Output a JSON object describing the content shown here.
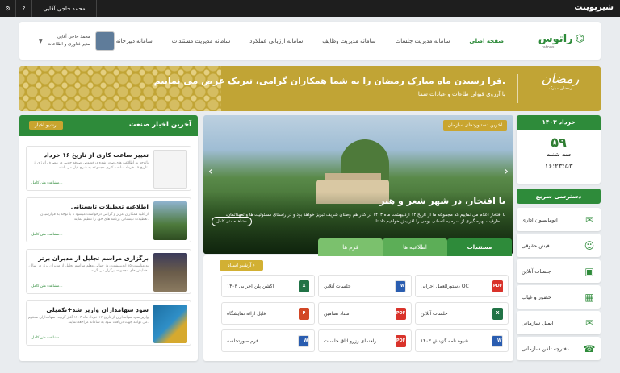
{
  "topbar": {
    "brand": "شیرپوینت",
    "user": "محمد حاجی آقایی",
    "help": "?"
  },
  "nav": {
    "logo": "راتوس",
    "logo_sub": "ratoos",
    "menu": [
      "صفحه اصلی",
      "سامانه مدیریت جلسات",
      "سامانه مدیریت وظایف",
      "سامانه ارزیابی عملکرد",
      "سامانه مدیریت مستندات",
      "سامانه دبیرخانه"
    ],
    "user_name": "محمد حاجی آقایی",
    "user_role": "مدیر فناوری و اطلاعات"
  },
  "banner": {
    "logo_text": "رمضان",
    "logo_sub": "رمضان مبارک",
    "title": "فرا رسیدن ماه مبارک رمضان را به شما همکاران گرامی، تبریک عرض می نماییم.",
    "subtitle": "با آرزوی قبولی طاعات و عبادات شما"
  },
  "date": {
    "month": "خرداد ۱۴۰۳",
    "day": "۵۹",
    "weekday": "سه شنبه",
    "time": "۱۶:۲۳:۵۳"
  },
  "quick": {
    "title": "دسترسی سریع",
    "items": [
      {
        "label": "اتوماسیون اداری",
        "icon": "mail-icon"
      },
      {
        "label": "فیش حقوقی",
        "icon": "salary-icon"
      },
      {
        "label": "جلسات آنلاین",
        "icon": "meeting-icon"
      },
      {
        "label": "حضور و غیاب",
        "icon": "calendar-icon"
      },
      {
        "label": "ایمیل سازمانی",
        "icon": "email-icon"
      },
      {
        "label": "دفترچه تلفن سازمانی",
        "icon": "phone-icon"
      }
    ]
  },
  "slider": {
    "tag": "آخرین دستاوردهای سازمان",
    "title": "با افتخار، در شهر شعر و هنر",
    "desc": "با افتخار اعلام می نماییم که مجموعه ما از تاریخ ۱۲ اردیبهشت ماه ۱۴۰۳ در کنار هم وطنان شریف تبریز خواهد بود و در راستای مسئولیت ها و تعهداتمان، ظرفیت بهره گیری از سرمایه انسانی بومی را افزایش خواهیم داد تا ...",
    "more": "مشاهده متن کامل"
  },
  "docs": {
    "tabs": [
      "مستندات",
      "اطلاعیه ها",
      "فرم ها"
    ],
    "archive": "آرشیو اسناد",
    "items": [
      {
        "label": "دستورالعمل اجرایی QC",
        "type": "PDF"
      },
      {
        "label": "جلسات آنلاین",
        "type": "W"
      },
      {
        "label": "اکشن پلن اجرایی ۱۴۰۳",
        "type": "X"
      },
      {
        "label": "جلسات آنلاین",
        "type": "X"
      },
      {
        "label": "اسناد تضامین",
        "type": "PDF"
      },
      {
        "label": "فایل ارائه نمایشگاه",
        "type": "P"
      },
      {
        "label": "شیوه نامه گزینش ۱۴۰۳",
        "type": "W"
      },
      {
        "label": "راهنمای رزرو اتاق جلسات",
        "type": "PDF"
      },
      {
        "label": "فرم صورتجلسه",
        "type": "W"
      }
    ]
  },
  "news": {
    "title": "آخرین اخبار صنعت",
    "archive": "آرشیو اخبار",
    "more": "مشاهده متن کامل...",
    "items": [
      {
        "title": "تغییر ساعت کاری از تاریخ ۱۶ خرداد",
        "desc": "باتوجه به اطلاعیه های صادر شده درخصوص صرفه جویی در مصرف انرژی از تاریخ ۱۶ خرداد ساعت کاری مجموعه به شرح ذیل می باشد."
      },
      {
        "title": "اطلاعیه تعطیلات تابستانی",
        "desc": "از کلیه همکاران عزیز و گرامی درخواست میشود تا با توجه به فرارسیدن تعطیلات تابستانی برنامه های خود را تنظیم نمایند."
      },
      {
        "title": "برگزاری مراسم تجلیل از مدیران برتر",
        "desc": "به مناسبت ۱۵ اردیبهشت روز جهانی معلم مراسم تجلیل از مدیران برتر در سالن همایش های مجموعه برگزار می گردد."
      },
      {
        "title": "سود سهامداران واریز شد+تکمیلی",
        "desc": "واریز سود سهامداران از تاریخ ۱۲ خرداد ماه ۱۴۰۳ آغاز گردید، سهامداران محترم می توانند جهت دریافت سود به سامانه مراجعه نمایند."
      }
    ]
  },
  "colors": {
    "primary": "#2e8b3a",
    "gold": "#c1a435",
    "topbar": "#1e1e1e"
  }
}
